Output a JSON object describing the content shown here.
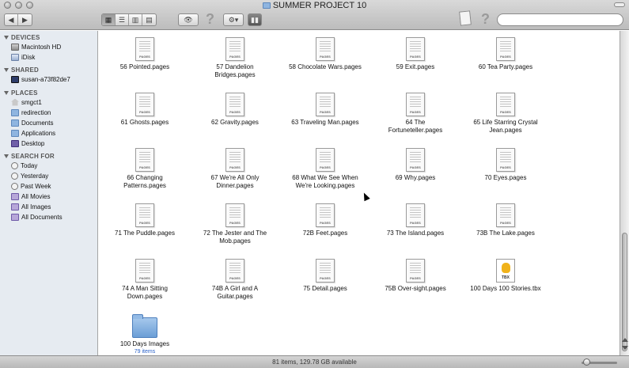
{
  "window": {
    "title": "SUMMER PROJECT 10"
  },
  "toolbar": {
    "back_label": "◀",
    "forward_label": "▶",
    "view_icons": [
      "icon-view-icon",
      "list-view-icon",
      "column-view-icon",
      "coverflow-view-icon"
    ],
    "eye_label": "👁",
    "help_label": "?",
    "action_label": "⚙▾",
    "search": {
      "placeholder": "",
      "value": ""
    }
  },
  "sidebar": {
    "devices_label": "DEVICES",
    "devices": [
      {
        "label": "Macintosh HD"
      },
      {
        "label": "iDisk"
      }
    ],
    "shared_label": "SHARED",
    "shared": [
      {
        "label": "susan-a73f82de7"
      }
    ],
    "places_label": "PLACES",
    "places": [
      {
        "label": "smgct1"
      },
      {
        "label": "redirection"
      },
      {
        "label": "Documents"
      },
      {
        "label": "Applications"
      },
      {
        "label": "Desktop"
      }
    ],
    "search_label": "SEARCH FOR",
    "searches": [
      {
        "label": "Today"
      },
      {
        "label": "Yesterday"
      },
      {
        "label": "Past Week"
      },
      {
        "label": "All Movies"
      },
      {
        "label": "All Images"
      },
      {
        "label": "All Documents"
      }
    ]
  },
  "files": [
    {
      "line1": "56 Pointed.pages",
      "line2": "",
      "kind": "pages"
    },
    {
      "line1": "57 Dandelion",
      "line2": "Bridges.pages",
      "kind": "pages"
    },
    {
      "line1": "58 Chocolate Wars.pages",
      "line2": "",
      "kind": "pages"
    },
    {
      "line1": "59 Exit.pages",
      "line2": "",
      "kind": "pages"
    },
    {
      "line1": "60 Tea Party.pages",
      "line2": "",
      "kind": "pages"
    },
    {
      "line1": "61 Ghosts.pages",
      "line2": "",
      "kind": "pages"
    },
    {
      "line1": "62 Gravity.pages",
      "line2": "",
      "kind": "pages"
    },
    {
      "line1": "63 Traveling Man.pages",
      "line2": "",
      "kind": "pages"
    },
    {
      "line1": "64 The",
      "line2": "Fortuneteller.pages",
      "kind": "pages"
    },
    {
      "line1": "65 Life Starring Crystal",
      "line2": "Jean.pages",
      "kind": "pages"
    },
    {
      "line1": "66 Changing",
      "line2": "Patterns.pages",
      "kind": "pages"
    },
    {
      "line1": "67 We're All Only",
      "line2": "Dinner.pages",
      "kind": "pages"
    },
    {
      "line1": "68 What We See When",
      "line2": "We're Looking.pages",
      "kind": "pages"
    },
    {
      "line1": "69 Why.pages",
      "line2": "",
      "kind": "pages"
    },
    {
      "line1": "70 Eyes.pages",
      "line2": "",
      "kind": "pages"
    },
    {
      "line1": "71 The Puddle.pages",
      "line2": "",
      "kind": "pages"
    },
    {
      "line1": "72 The Jester and The",
      "line2": "Mob.pages",
      "kind": "pages"
    },
    {
      "line1": "72B Feet.pages",
      "line2": "",
      "kind": "pages"
    },
    {
      "line1": "73 The Island.pages",
      "line2": "",
      "kind": "pages"
    },
    {
      "line1": "73B The Lake.pages",
      "line2": "",
      "kind": "pages"
    },
    {
      "line1": "74 A Man Sitting",
      "line2": "Down.pages",
      "kind": "pages"
    },
    {
      "line1": "74B A Girl and A",
      "line2": "Guitar.pages",
      "kind": "pages"
    },
    {
      "line1": "75 Detail.pages",
      "line2": "",
      "kind": "pages"
    },
    {
      "line1": "75B Over-sight.pages",
      "line2": "",
      "kind": "pages"
    },
    {
      "line1": "100 Days 100 Stories.tbx",
      "line2": "",
      "kind": "tbx"
    },
    {
      "line1": "100 Days Images",
      "line2": "",
      "sub": "79 items",
      "kind": "folder"
    }
  ],
  "icon_tags": {
    "pages": "PAGES",
    "tbx": "TBX"
  },
  "status": {
    "text": "81 items, 129.78 GB available"
  }
}
